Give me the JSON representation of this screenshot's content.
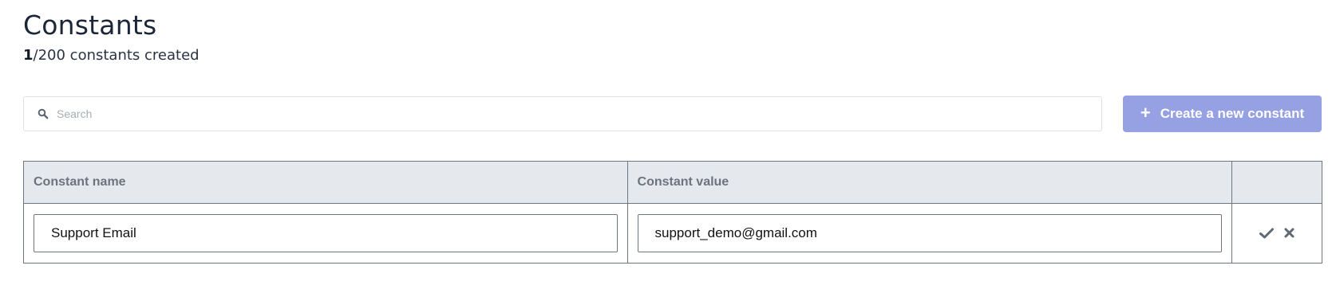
{
  "header": {
    "title": "Constants",
    "count_current": "1",
    "count_rest": "/200 constants created"
  },
  "search": {
    "placeholder": "Search",
    "icon": "search-icon"
  },
  "create_button": {
    "icon": "plus-icon",
    "label": "Create a new constant",
    "color": "#95a1e3"
  },
  "table": {
    "columns": [
      "Constant name",
      "Constant value",
      ""
    ],
    "rows": [
      {
        "name": "Support Email",
        "value": "support_demo@gmail.com",
        "actions": [
          "check-icon",
          "close-icon"
        ]
      }
    ]
  },
  "colors": {
    "header_bg": "#e5e8ec",
    "border": "#6f7680",
    "title": "#1b2638",
    "header_text": "#6b7480"
  }
}
